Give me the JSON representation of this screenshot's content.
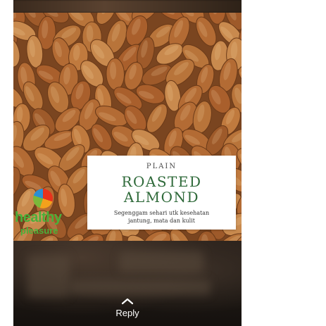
{
  "story": {
    "image_card": {
      "kicker": "PLAIN",
      "title_line1": "ROASTED",
      "title_line2": "ALMOND",
      "subtitle_line1": "Segenggam sehari utk kesehatan",
      "subtitle_line2": "jantung, mata dan kulit"
    },
    "watermark_logo": {
      "word1": "healthy",
      "word2": "pleasure"
    },
    "reply": {
      "icon": "chevron-up-icon",
      "label": "Reply"
    }
  },
  "colors": {
    "title_green": "#2f6a3a",
    "logo_green": "#4bb03a",
    "almond_brown": "#b36b34",
    "viewer_background": "#1a1410"
  }
}
